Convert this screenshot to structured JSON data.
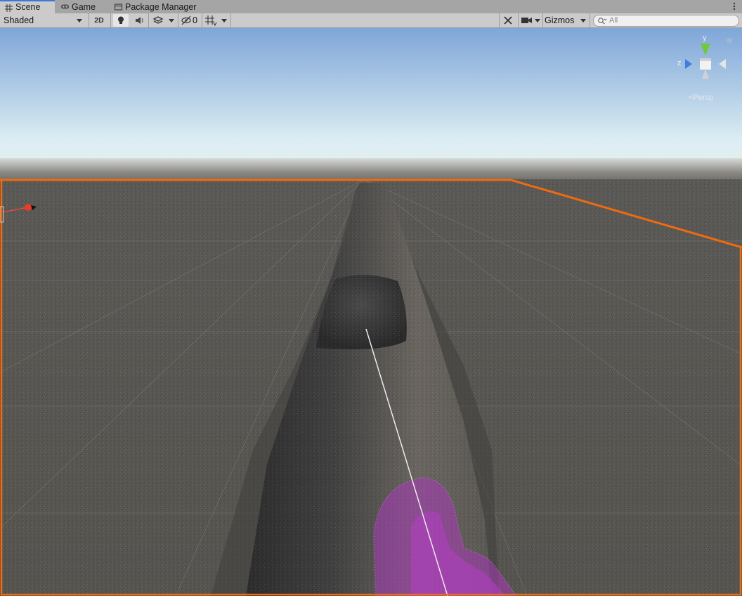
{
  "tabs": [
    {
      "label": "Scene",
      "icon": "grid-icon",
      "active": true
    },
    {
      "label": "Game",
      "icon": "gamepad-icon",
      "active": false
    },
    {
      "label": "Package Manager",
      "icon": "package-icon",
      "active": false
    }
  ],
  "toolbar": {
    "draw_mode": "Shaded",
    "mode_2d": "2D",
    "hidden_count": "0",
    "gizmos_label": "Gizmos",
    "search_placeholder": "All"
  },
  "scene_gizmo": {
    "axis_y": "y",
    "axis_z": "z",
    "projection": "Persp"
  },
  "colors": {
    "selection_outline": "#f06a10",
    "brush_preview": "#c23ed6",
    "sky_top": "#7fa6d9",
    "ground": "#5c5a55"
  }
}
